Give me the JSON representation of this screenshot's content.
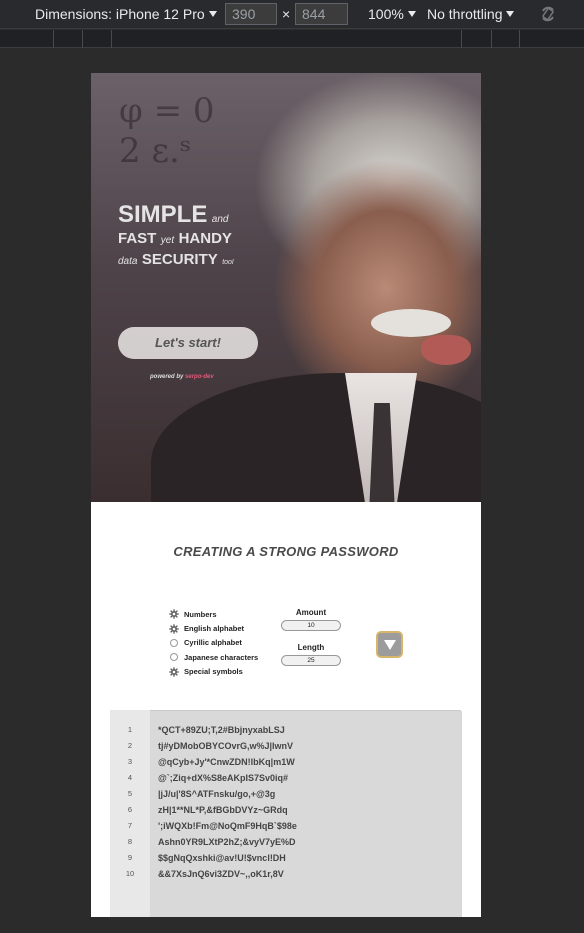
{
  "devtools": {
    "dimensions_label": "Dimensions: iPhone 12 Pro",
    "width_value": "390",
    "height_value": "844",
    "times": "×",
    "zoom": "100%",
    "throttling": "No throttling"
  },
  "hero": {
    "line1_big": "SIMPLE",
    "line1_small": "and",
    "line2_big": "FAST",
    "line2_small": "yet",
    "line2_big2": "HANDY",
    "line3_small": "data",
    "line3_big": "SECURITY",
    "line3_small2": "tool",
    "start_button": "Let's start!",
    "powered_prefix": "powered by",
    "powered_name": "serpo-dev",
    "equation_top": "φ = 0",
    "equation_bottom": "2 ε.ˢ"
  },
  "generator": {
    "title": "CREATING A STRONG PASSWORD",
    "options": [
      {
        "label": "Numbers",
        "checked": true
      },
      {
        "label": "English alphabet",
        "checked": true
      },
      {
        "label": "Cyrillic alphabet",
        "checked": false
      },
      {
        "label": "Japanese characters",
        "checked": false
      },
      {
        "label": "Special symbols",
        "checked": true
      }
    ],
    "amount_label": "Amount",
    "amount_value": "10",
    "length_label": "Length",
    "length_value": "25"
  },
  "output": {
    "rows": [
      {
        "num": "1",
        "text": "*QCT+89ZU;T,2#BbjnyxabLSJ"
      },
      {
        "num": "2",
        "text": "tj#yDMobOBYCOvrG,w%J|lwnV"
      },
      {
        "num": "3",
        "text": "@qCyb+Jy'*CnwZDN!lbKq|m1W"
      },
      {
        "num": "4",
        "text": "@`;Ziq+dX%S8eAKpIS7Sv0iq#"
      },
      {
        "num": "5",
        "text": "|jJ/u|'8S^ATFnsku/go,+@3g"
      },
      {
        "num": "6",
        "text": "zH|1**NL*P,&fBGbDVYz~GRdq"
      },
      {
        "num": "7",
        "text": "';iWQXb!Fm@NoQmF9HqB`$98e"
      },
      {
        "num": "8",
        "text": "Ashn0YR9LXtP2hZ;&vyV7yE%D"
      },
      {
        "num": "9",
        "text": "$$gNqQxshki@av!U!$vncl!DH"
      },
      {
        "num": "10",
        "text": "&&7XsJnQ6vi3ZDV~,,oK1r,8V"
      }
    ]
  }
}
